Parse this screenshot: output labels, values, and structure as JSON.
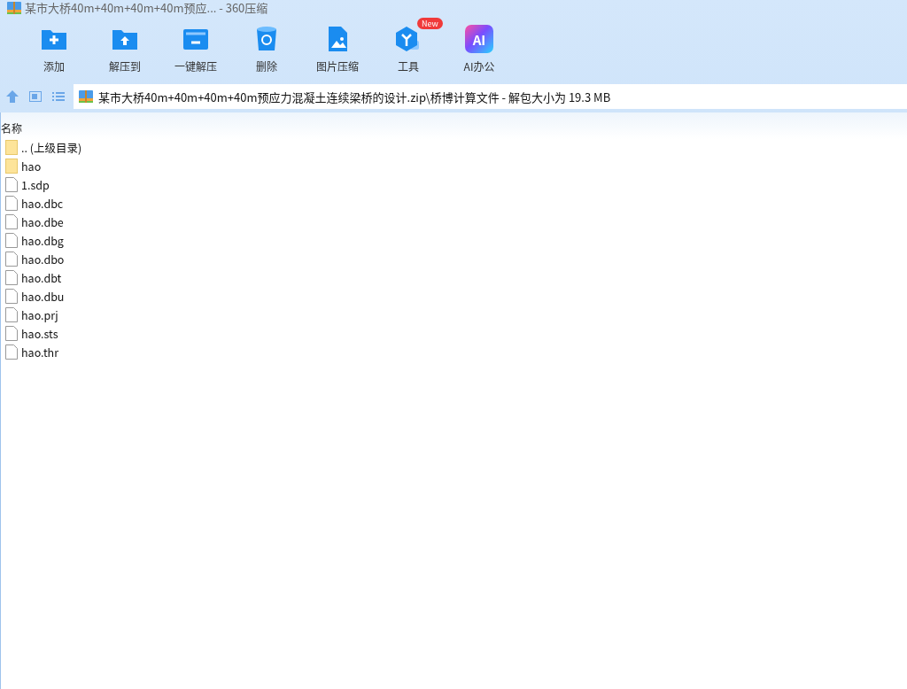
{
  "window": {
    "title": "某市大桥40m+40m+40m+40m预应... - 360压缩"
  },
  "toolbar": [
    {
      "label": "添加",
      "kind": "add"
    },
    {
      "label": "解压到",
      "kind": "extract"
    },
    {
      "label": "一键解压",
      "kind": "oneclick"
    },
    {
      "label": "删除",
      "kind": "delete"
    },
    {
      "label": "图片压缩",
      "kind": "image"
    },
    {
      "label": "工具",
      "kind": "tools",
      "badge": "New"
    },
    {
      "label": "AI办公",
      "kind": "ai",
      "icon_text": "AI"
    }
  ],
  "address": {
    "path": "某市大桥40m+40m+40m+40m预应力混凝土连续梁桥的设计.zip\\桥博计算文件 - 解包大小为 19.3 MB"
  },
  "table": {
    "columns": [
      "名称"
    ],
    "rows": [
      {
        "name": ".. (上级目录)",
        "kind": "folder"
      },
      {
        "name": "hao",
        "kind": "folder"
      },
      {
        "name": "1.sdp",
        "kind": "file"
      },
      {
        "name": "hao.dbc",
        "kind": "file"
      },
      {
        "name": "hao.dbe",
        "kind": "file"
      },
      {
        "name": "hao.dbg",
        "kind": "file"
      },
      {
        "name": "hao.dbo",
        "kind": "file"
      },
      {
        "name": "hao.dbt",
        "kind": "file"
      },
      {
        "name": "hao.dbu",
        "kind": "file"
      },
      {
        "name": "hao.prj",
        "kind": "file"
      },
      {
        "name": "hao.sts",
        "kind": "file"
      },
      {
        "name": "hao.thr",
        "kind": "file"
      }
    ]
  }
}
